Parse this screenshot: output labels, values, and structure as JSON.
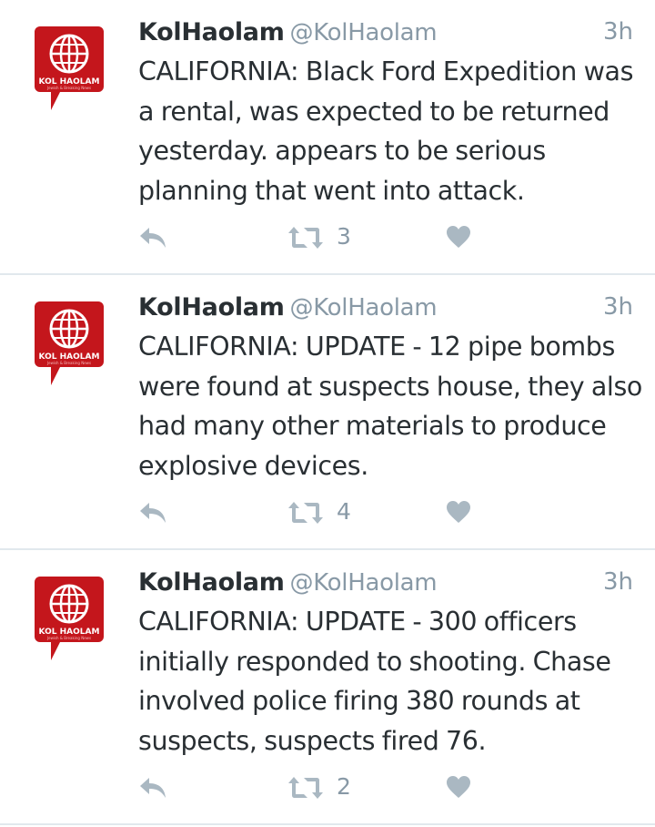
{
  "brand": {
    "avatar_text": "KOL HAOLAM",
    "avatar_tagline": "Jewish & Breaking News",
    "color": "#c4161c"
  },
  "icons": {
    "avatar": "globe-logo",
    "reply": "reply-icon",
    "retweet": "retweet-icon",
    "like": "heart-icon"
  },
  "tweets": [
    {
      "name": "KolHaolam",
      "handle": "@KolHaolam",
      "time": "3h",
      "text": "CALIFORNIA: Black Ford Expedition was a rental, was expected to be returned yesterday. appears to be serious planning that went into attack.",
      "retweets": "3"
    },
    {
      "name": "KolHaolam",
      "handle": "@KolHaolam",
      "time": "3h",
      "text": "CALIFORNIA: UPDATE - 12 pipe bombs were found at suspects house, they also had many other materials to produce explosive devices.",
      "retweets": "4"
    },
    {
      "name": "KolHaolam",
      "handle": "@KolHaolam",
      "time": "3h",
      "text": "CALIFORNIA: UPDATE - 300 officers initially responded to shooting. Chase involved police firing 380 rounds at suspects, suspects fired 76.",
      "retweets": "2"
    }
  ]
}
